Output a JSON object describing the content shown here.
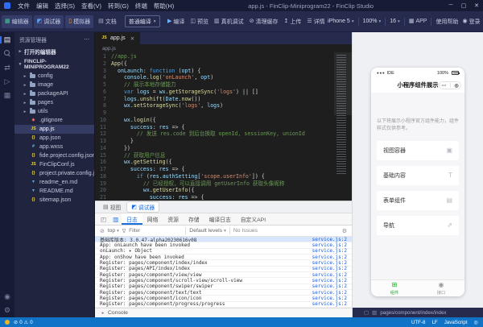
{
  "titlebar": {
    "menus": [
      "文件",
      "编辑",
      "选择(S)",
      "查看(V)",
      "转到(G)",
      "终端",
      "帮助(H)"
    ],
    "title": "app.js - FinClip-Miniprogram22 - FinClip Studio",
    "window_controls": [
      "minimize",
      "maximize",
      "close"
    ]
  },
  "toolbar": {
    "panels": [
      {
        "label": "编辑器",
        "icon": "editor",
        "active": true
      },
      {
        "label": "调试器",
        "icon": "debugger",
        "active": true
      },
      {
        "label": "模拟器",
        "icon": "simulator",
        "active": true
      },
      {
        "label": "文档",
        "icon": "docs",
        "active": false
      }
    ],
    "compile_mode": {
      "value": "普通编译"
    },
    "actions": [
      {
        "label": "编译",
        "icon": "compile"
      },
      {
        "label": "预览",
        "icon": "preview"
      },
      {
        "label": "真机调试",
        "icon": "remote-debug"
      },
      {
        "label": "清理缓存",
        "icon": "clear-cache"
      },
      {
        "label": "上传",
        "icon": "upload"
      },
      {
        "label": "详情",
        "icon": "details"
      }
    ],
    "device": {
      "value": "iPhone 5"
    },
    "zoom": {
      "value": "100%"
    },
    "font_size": {
      "value": "16"
    },
    "app_button": "APP",
    "help_button": "使用帮助",
    "login_button": "登录"
  },
  "activity_bar": {
    "top": [
      {
        "name": "explorer",
        "active": true
      },
      {
        "name": "search",
        "active": false
      },
      {
        "name": "source-control",
        "active": false
      },
      {
        "name": "debug",
        "active": false
      },
      {
        "name": "extensions",
        "active": false
      }
    ],
    "bottom": [
      {
        "name": "account",
        "active": false
      },
      {
        "name": "settings",
        "active": false
      }
    ]
  },
  "explorer": {
    "title": "资源管理器",
    "sections": {
      "open_editors": "打开的编辑器",
      "project": "FINCLIP-MINIPROGRAM22"
    },
    "folders": [
      "config",
      "image",
      "packageAPI",
      "pages",
      "utils"
    ],
    "files": [
      {
        "name": ".gitignore",
        "type": "git",
        "selected": false
      },
      {
        "name": "app.js",
        "type": "js",
        "selected": true
      },
      {
        "name": "app.json",
        "type": "json",
        "selected": false
      },
      {
        "name": "app.wxss",
        "type": "css",
        "selected": false
      },
      {
        "name": "fide.project.config.json",
        "type": "json",
        "selected": false
      },
      {
        "name": "FinClipConf.js",
        "type": "js",
        "selected": false
      },
      {
        "name": "project.private.config.json",
        "type": "json",
        "selected": false
      },
      {
        "name": "readme_en.md",
        "type": "md",
        "selected": false
      },
      {
        "name": "README.md",
        "type": "md",
        "selected": false
      },
      {
        "name": "sitemap.json",
        "type": "json",
        "selected": false
      }
    ]
  },
  "editor": {
    "tab": "app.js",
    "breadcrumb": "app.js",
    "code": [
      "//app.js",
      "App({",
      "  onLaunch: function (opt) {",
      "    console.log('onLaunch', opt)",
      "    // 展示本地存储能力",
      "    var logs = wx.getStorageSync('logs') || []",
      "    logs.unshift(Date.now())",
      "    wx.setStorageSync('logs', logs)",
      "",
      "    wx.login({",
      "      success: res => {",
      "        // 发送 res.code 到后台换取 openId, sessionKey, unionId",
      "      }",
      "    })",
      "    // 获取用户信息",
      "    wx.getSetting({",
      "      success: res => {",
      "        if (res.authSetting['scope.userInfo']) {",
      "          // 已经授权，可以直接调用 getUserInfo 获取头像昵称",
      "          wx.getUserInfo({",
      "            success: res => {"
    ]
  },
  "debug_panel": {
    "view_toggles": [
      {
        "label": "视图",
        "icon": "views",
        "active": false
      },
      {
        "label": "调试器",
        "icon": "debugger",
        "active": true
      }
    ],
    "tabs": [
      {
        "label": "日志",
        "active": true
      },
      {
        "label": "网络",
        "active": false
      },
      {
        "label": "资源",
        "active": false
      },
      {
        "label": "存储",
        "active": false
      },
      {
        "label": "编译日志",
        "active": false
      },
      {
        "label": "自定义API",
        "active": false
      }
    ],
    "toolbar": {
      "context": "top",
      "filter_placeholder": "Filter",
      "levels": "Default levels",
      "issues": "No Issues"
    },
    "logs": [
      {
        "text": "基础库版本: 3.0.47-alpha20230616v08",
        "source": "service.js:2",
        "selected": true
      },
      {
        "text": "App: onLaunch have been invoked",
        "source": "service.js:2",
        "selected": false
      },
      {
        "text": "onLaunch: ▸ Object",
        "source": "service.js:2",
        "selected": false
      },
      {
        "text": "App: onShow have been invoked",
        "source": "service.js:2",
        "selected": false
      },
      {
        "text": "Register: pages/component/index/index",
        "source": "service.js:2",
        "selected": false
      },
      {
        "text": "Register: pages/API/index/index",
        "source": "service.js:2",
        "selected": false
      },
      {
        "text": "Register: pages/component/view/view",
        "source": "service.js:2",
        "selected": false
      },
      {
        "text": "Register: pages/component/scroll-view/scroll-view",
        "source": "service.js:2",
        "selected": false
      },
      {
        "text": "Register: pages/component/swiper/swiper",
        "source": "service.js:2",
        "selected": false
      },
      {
        "text": "Register: pages/component/text/text",
        "source": "service.js:2",
        "selected": false
      },
      {
        "text": "Register: pages/component/icon/icon",
        "source": "service.js:2",
        "selected": false
      },
      {
        "text": "Register: pages/component/progress/progress",
        "source": "service.js:2",
        "selected": false
      }
    ],
    "drawer_label": "Console"
  },
  "simulator": {
    "status": {
      "carrier": "IDE",
      "battery": "100%"
    },
    "nav_title": "小程序组件展示",
    "intro": "以下将展示小程序官方组件能力，组件样式仅供参考。",
    "menu": [
      {
        "label": "视图容器",
        "icon": "view-container"
      },
      {
        "label": "基础内容",
        "icon": "basic-content"
      },
      {
        "label": "表单组件",
        "icon": "form"
      },
      {
        "label": "导航",
        "icon": "navigation"
      }
    ],
    "tab_bar": [
      {
        "label": "组件",
        "icon": "components",
        "active": true
      },
      {
        "label": "接口",
        "icon": "api",
        "active": false
      }
    ],
    "page_path": "pages/component/index/index"
  },
  "status_bar": {
    "errors": "0",
    "warnings": "0",
    "items": [
      "UTF-8",
      "LF",
      "JavaScript"
    ]
  }
}
